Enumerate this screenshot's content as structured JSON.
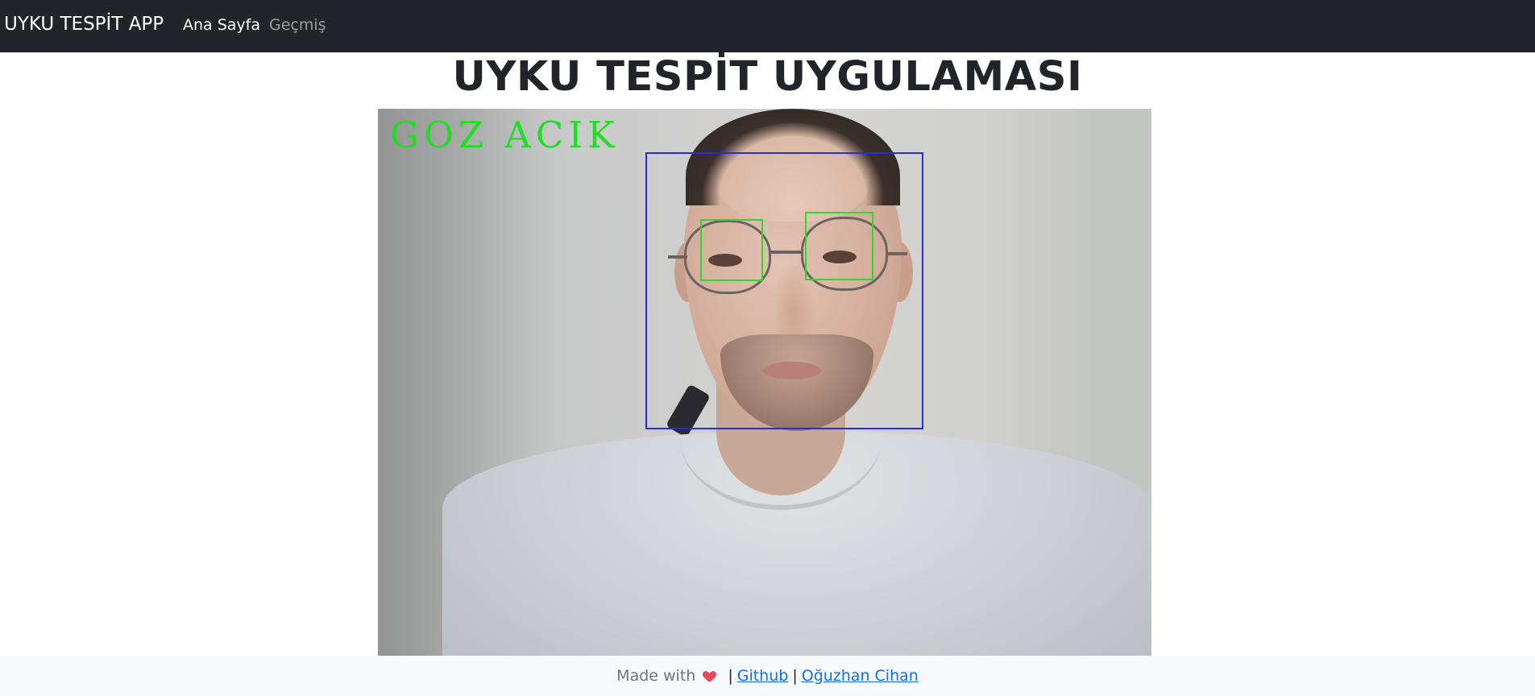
{
  "navbar": {
    "brand": "UYKU TESPİT APP",
    "links": [
      {
        "label": "Ana Sayfa",
        "active": true
      },
      {
        "label": "Geçmiş",
        "active": false
      }
    ]
  },
  "main": {
    "title": "UYKU TESPİT UYGULAMASI",
    "camera_feed": {
      "status_text": "GOZ ACIK",
      "status_color": "#22dd22",
      "face_box_color": "#2a2ae6",
      "eye_box_color": "#2fd82f"
    }
  },
  "footer": {
    "made_with": "Made with",
    "heart_icon": "heart-icon",
    "separator": "|",
    "github_label": "Github",
    "author_label": "Oğuzhan Cihan"
  },
  "colors": {
    "navbar_bg": "#212529",
    "footer_bg": "#f8f9fa",
    "link": "#0d6efd"
  }
}
